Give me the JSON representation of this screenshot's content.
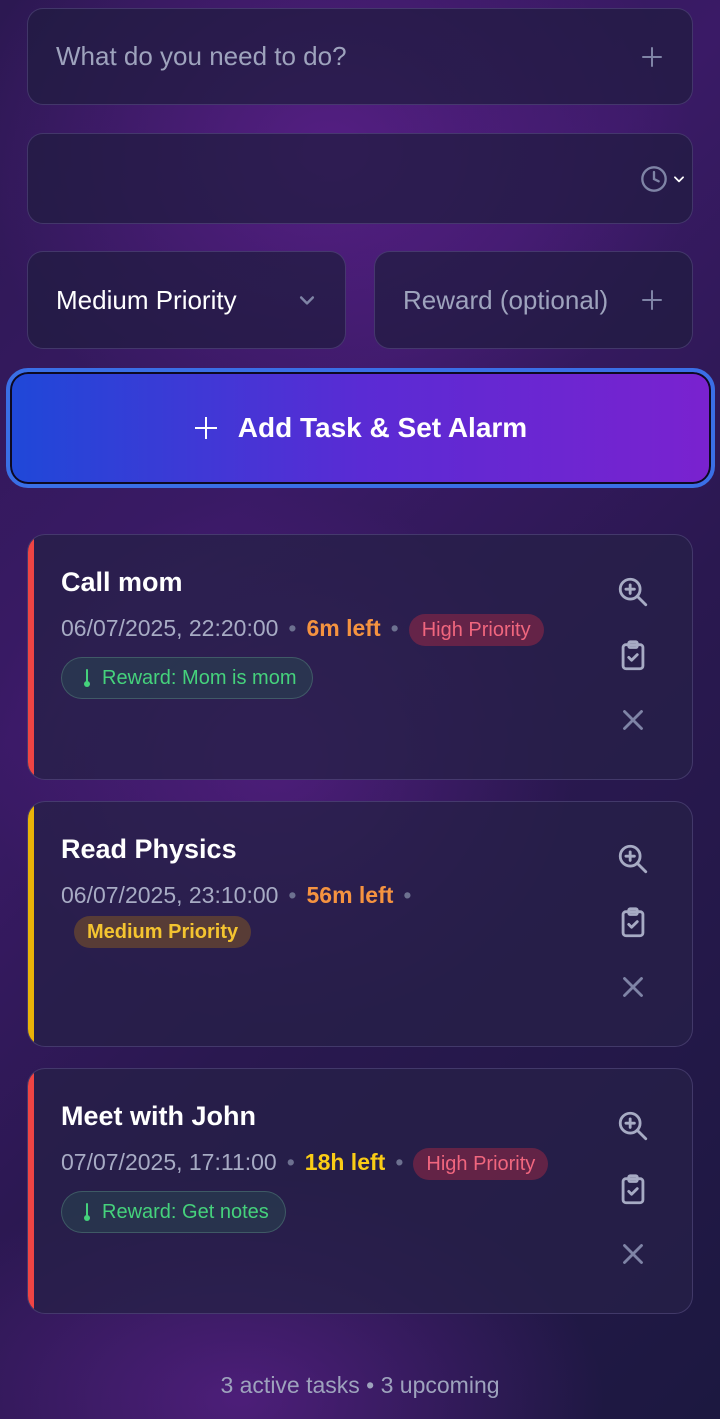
{
  "form": {
    "task_placeholder": "What do you need to do?",
    "datetime_value": "",
    "priority_value": "Medium Priority",
    "reward_placeholder": "Reward (optional)",
    "add_button_label": "Add Task & Set Alarm"
  },
  "tasks": [
    {
      "title": "Call mom",
      "datetime": "06/07/2025, 22:20:00",
      "time_left": "6m left",
      "time_left_color": "#f59340",
      "priority": "High Priority",
      "priority_level": "high",
      "accent_color": "#ef4444",
      "reward": "Reward: Mom is mom"
    },
    {
      "title": "Read Physics",
      "datetime": "06/07/2025, 23:10:00",
      "time_left": "56m left",
      "time_left_color": "#f59340",
      "priority": "Medium Priority",
      "priority_level": "medium",
      "accent_color": "#eab308",
      "reward": ""
    },
    {
      "title": "Meet with John",
      "datetime": "07/07/2025, 17:11:00",
      "time_left": "18h left",
      "time_left_color": "#facc15",
      "priority": "High Priority",
      "priority_level": "high",
      "accent_color": "#ef4444",
      "reward": "Reward: Get notes"
    }
  ],
  "footer": {
    "summary": "3 active tasks • 3 upcoming"
  }
}
